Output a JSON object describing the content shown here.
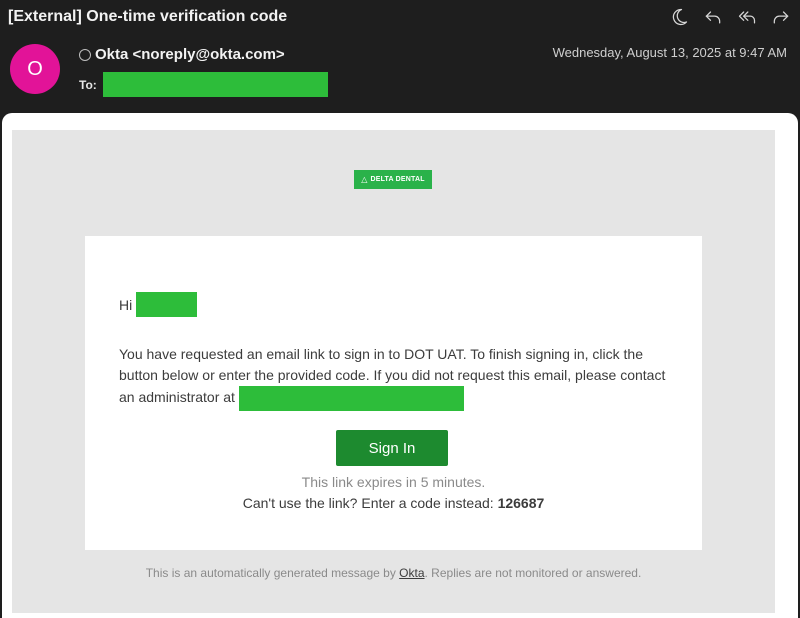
{
  "header": {
    "subject": "[External] One-time verification code",
    "toolbar": [
      "moon-icon",
      "reply-icon",
      "reply-all-icon",
      "forward-icon"
    ],
    "avatar_initial": "O",
    "avatar_color": "#e21398",
    "sender": "Okta <noreply@okta.com>",
    "to_label": "To:",
    "date": "Wednesday, August 13, 2025 at 9:47 AM"
  },
  "email": {
    "logo_text": "DELTA DENTAL",
    "logo_color": "#2ab24a",
    "greeting": "Hi",
    "body_text": "You have requested an email link to sign in to DOT UAT. To finish signing in, click the button below or enter the provided code. If you did not request this email, please contact an administrator at",
    "sign_in_label": "Sign In",
    "button_color": "#1d8a2f",
    "expires_text": "This link expires in 5 minutes.",
    "code_prompt": "Can't use the link? Enter a code instead:",
    "code": "126687",
    "footer_prefix": "This is an automatically generated message by",
    "footer_link": "Okta",
    "footer_suffix": ". Replies are not monitored or answered."
  },
  "redaction_color": "#2dbd3a"
}
